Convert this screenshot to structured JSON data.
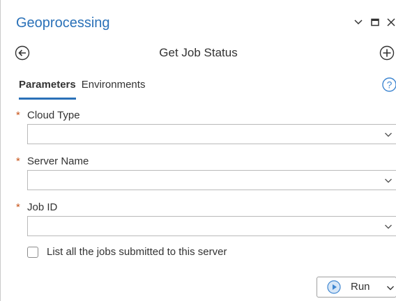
{
  "pane": {
    "title": "Geoprocessing",
    "controls": [
      "chevron-down-icon",
      "maximize-icon",
      "close-icon"
    ]
  },
  "tool": {
    "title": "Get Job Status",
    "back_icon": "back-arrow-circle-icon",
    "add_icon": "plus-circle-icon"
  },
  "tabs": {
    "parameters": "Parameters",
    "environments": "Environments",
    "active": "Parameters"
  },
  "help_icon": "help-question-icon",
  "required_marker": "*",
  "fields": {
    "cloud_type": {
      "label": "Cloud Type",
      "value": ""
    },
    "server_name": {
      "label": "Server Name",
      "value": ""
    },
    "job_id": {
      "label": "Job ID",
      "value": ""
    }
  },
  "checkbox": {
    "label": "List all the jobs submitted to this server",
    "checked": false
  },
  "run": {
    "label": "Run",
    "icon": "play-circle-icon"
  },
  "colors": {
    "accent": "#2a71b8",
    "required": "#c8541a",
    "run_icon": "#3e86d1"
  }
}
